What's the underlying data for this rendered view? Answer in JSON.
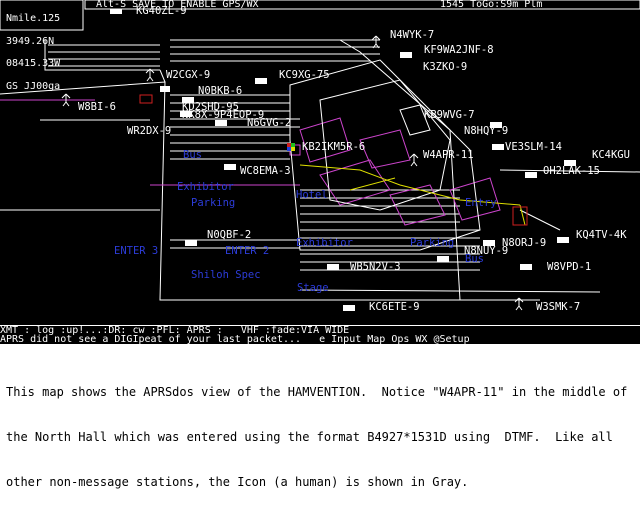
{
  "header": {
    "hdr_line1": "Nmile.125",
    "hdr_line2": "3949.26N",
    "hdr_line3": "08415.33W",
    "hdr_line4": "GS JJ00ga",
    "message": "Alt-S SAVE TO ENABLE GPS/WX",
    "right_status": "1545 ToGo:S9m Plm"
  },
  "stations": [
    {
      "label": "KG40ZL-9"
    },
    {
      "label": "N4WYK-7"
    },
    {
      "label": "KF9WA2JNF-8"
    },
    {
      "label": "K3ZKO-9"
    },
    {
      "label": "W2CGX-9"
    },
    {
      "label": "KC9XG-75"
    },
    {
      "label": "N0BKB-6"
    },
    {
      "label": "W8BI-6"
    },
    {
      "label": "KD2SHD-95"
    },
    {
      "label": "NK8X-9P4EOP-9"
    },
    {
      "label": "N6GVG-2"
    },
    {
      "label": "KB9WVG-7"
    },
    {
      "label": "WR2DX-9"
    },
    {
      "label": "N8HQY-9"
    },
    {
      "label": "KB2IKM5R-6"
    },
    {
      "label": "W4APR-11"
    },
    {
      "label": "VE3SLM-14"
    },
    {
      "label": "KC4KGU"
    },
    {
      "label": "WC8EMA-3"
    },
    {
      "label": "OH2LAK-15"
    },
    {
      "label": "N0QBF-2"
    },
    {
      "label": "KQ4TV-4K"
    },
    {
      "label": "N8ORJ-9"
    },
    {
      "label": "N8NUY-9"
    },
    {
      "label": "W8VPD-1"
    },
    {
      "label": "WB5N2V-3"
    },
    {
      "label": "KC6ETE-9"
    },
    {
      "label": "W3SMK-7"
    }
  ],
  "map_labels": [
    {
      "label": "Bus"
    },
    {
      "label": "Exhibitor"
    },
    {
      "label": "Parking"
    },
    {
      "label": "Hotel"
    },
    {
      "label": "Entry"
    },
    {
      "label": "ENTER 3"
    },
    {
      "label": "ENTER 2"
    },
    {
      "label": "Exhibitor"
    },
    {
      "label": "Parking"
    },
    {
      "label": "Shiloh Spec"
    },
    {
      "label": "Bus"
    },
    {
      "label": "Stage"
    }
  ],
  "status": {
    "line1": "XMT : log :up!...:DR: cw :PFL: APRS :   VHF :fade:VIA WIDE",
    "line2": "APRS did not see a DIGIpeat of your last packet...   e Input Map Ops WX @Setup"
  },
  "caption": {
    "line1": "This map shows the APRSdos view of the HAMVENTION.  Notice \"W4APR-11\" in the middle of",
    "line2": "the North Hall which was entered using the format B4927*1531D using  DTMF.  Like all",
    "line3": "other non-message stations, the Icon (a human) is shown in Gray."
  },
  "colors": {
    "background": "#000000",
    "station_text": "#ffffff",
    "map_label": "#2c3cd8",
    "hall_outline": "#cc44cc",
    "yellow_roads": "#e0e000",
    "red_marker": "#d02020"
  }
}
